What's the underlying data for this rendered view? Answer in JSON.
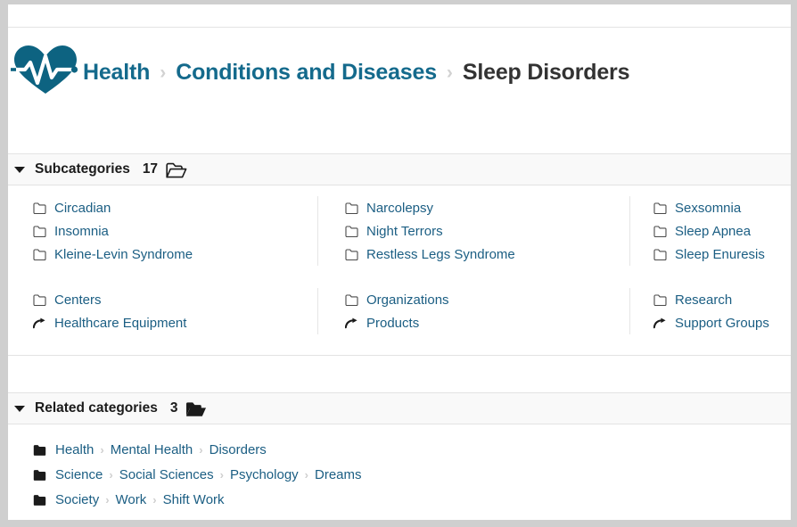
{
  "header": {
    "logo_icon": "heart-pulse-icon",
    "breadcrumb": [
      {
        "label": "Health",
        "current": false
      },
      {
        "label": "Conditions and Diseases",
        "current": false
      },
      {
        "label": "Sleep Disorders",
        "current": true
      }
    ],
    "separator": "›"
  },
  "sections": {
    "subcategories": {
      "title": "Subcategories",
      "count": "17",
      "caret_icon": "caret-down-icon",
      "folder_icon": "folder-open-outline-icon",
      "groups": [
        {
          "columns": [
            [
              {
                "label": "Circadian",
                "icon": "folder-outline-icon"
              },
              {
                "label": "Insomnia",
                "icon": "folder-outline-icon"
              },
              {
                "label": "Kleine-Levin Syndrome",
                "icon": "folder-outline-icon"
              }
            ],
            [
              {
                "label": "Narcolepsy",
                "icon": "folder-outline-icon"
              },
              {
                "label": "Night Terrors",
                "icon": "folder-outline-icon"
              },
              {
                "label": "Restless Legs Syndrome",
                "icon": "folder-outline-icon"
              }
            ],
            [
              {
                "label": "Sexsomnia",
                "icon": "folder-outline-icon"
              },
              {
                "label": "Sleep Apnea",
                "icon": "folder-outline-icon"
              },
              {
                "label": "Sleep Enuresis",
                "icon": "folder-outline-icon"
              }
            ]
          ]
        },
        {
          "columns": [
            [
              {
                "label": "Centers",
                "icon": "folder-outline-icon"
              },
              {
                "label": "Healthcare Equipment",
                "icon": "arrow-redirect-icon"
              }
            ],
            [
              {
                "label": "Organizations",
                "icon": "folder-outline-icon"
              },
              {
                "label": "Products",
                "icon": "arrow-redirect-icon"
              }
            ],
            [
              {
                "label": "Research",
                "icon": "folder-outline-icon"
              },
              {
                "label": "Support Groups",
                "icon": "arrow-redirect-icon"
              }
            ]
          ]
        }
      ]
    },
    "related": {
      "title": "Related categories",
      "count": "3",
      "caret_icon": "caret-down-icon",
      "folder_icon": "folder-open-solid-icon",
      "separator": "›",
      "rows": [
        {
          "icon": "folder-solid-icon",
          "parts": [
            "Health",
            "Mental Health",
            "Disorders"
          ]
        },
        {
          "icon": "folder-solid-icon",
          "parts": [
            "Science",
            "Social Sciences",
            "Psychology",
            "Dreams"
          ]
        },
        {
          "icon": "folder-solid-icon",
          "parts": [
            "Society",
            "Work",
            "Shift Work"
          ]
        }
      ]
    }
  },
  "colors": {
    "brand_teal": "#146a8c",
    "link": "#1b5e83",
    "current_crumb": "#333333",
    "band_bg": "#f9f9f9",
    "border": "#e3e3e3",
    "frame": "#cfcfcf"
  }
}
